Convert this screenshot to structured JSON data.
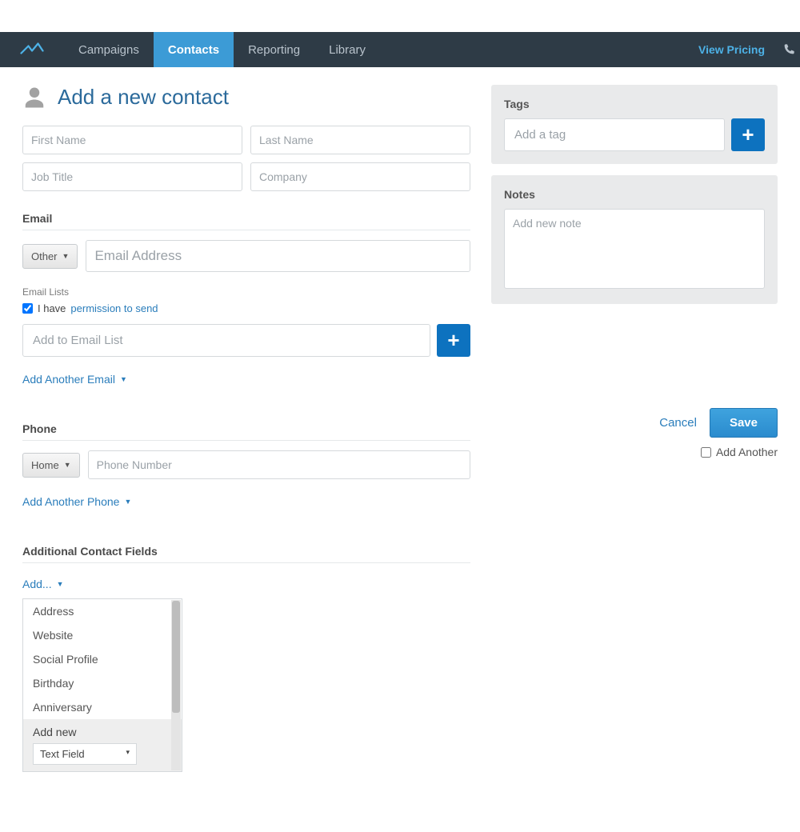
{
  "nav": {
    "items": [
      "Campaigns",
      "Contacts",
      "Reporting",
      "Library"
    ],
    "active": 1,
    "pricing": "View Pricing"
  },
  "page": {
    "title": "Add a new contact",
    "fields": {
      "first_name_ph": "First Name",
      "last_name_ph": "Last Name",
      "job_title_ph": "Job Title",
      "company_ph": "Company"
    },
    "email": {
      "label": "Email",
      "type_selected": "Other",
      "address_ph": "Email Address",
      "lists_label": "Email Lists",
      "permission_prefix": "I have ",
      "permission_link": "permission to send",
      "permission_checked": true,
      "add_list_ph": "Add to Email List",
      "add_another": "Add Another Email"
    },
    "phone": {
      "label": "Phone",
      "type_selected": "Home",
      "number_ph": "Phone Number",
      "add_another": "Add Another Phone"
    },
    "additional": {
      "label": "Additional Contact Fields",
      "add_link": "Add...",
      "options": [
        "Address",
        "Website",
        "Social Profile",
        "Birthday",
        "Anniversary"
      ],
      "add_new_label": "Add new",
      "add_new_type": "Text Field"
    }
  },
  "sidebar": {
    "tags": {
      "label": "Tags",
      "placeholder": "Add a tag"
    },
    "notes": {
      "label": "Notes",
      "placeholder": "Add new note"
    }
  },
  "actions": {
    "cancel": "Cancel",
    "save": "Save",
    "add_another": "Add Another"
  }
}
